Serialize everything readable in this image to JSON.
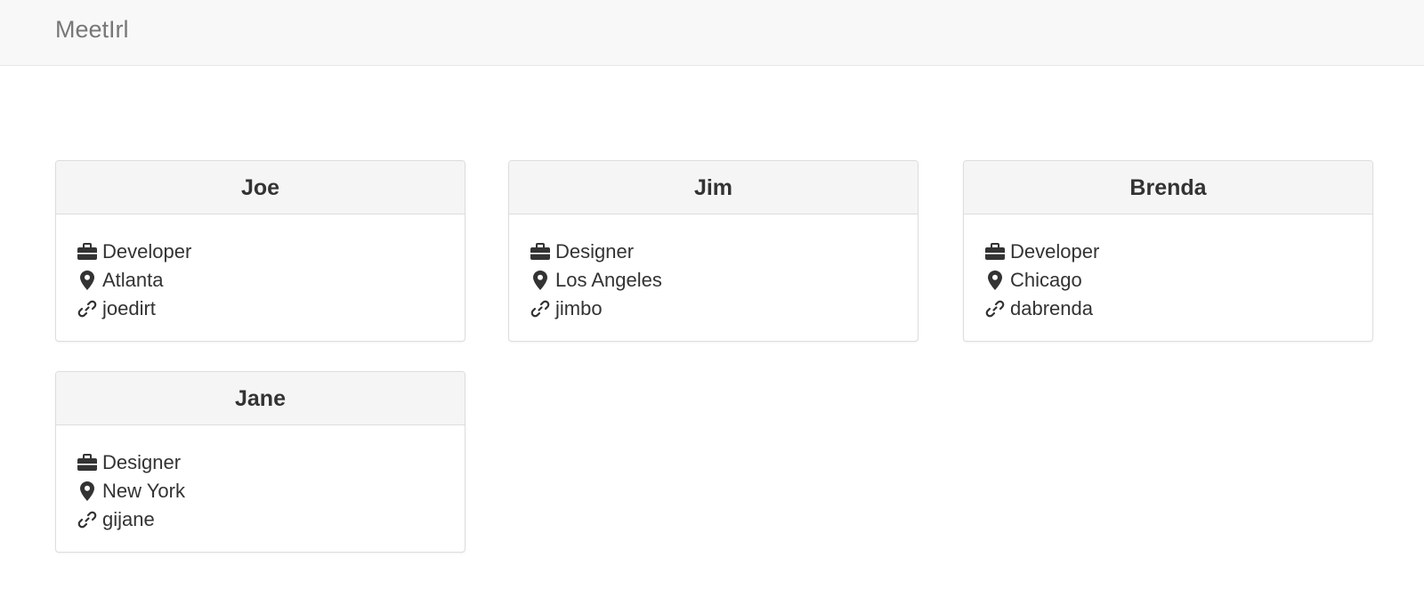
{
  "navbar": {
    "brand": "MeetIrl"
  },
  "people": [
    {
      "name": "Joe",
      "role": "Developer",
      "location": "Atlanta",
      "handle": "joedirt"
    },
    {
      "name": "Jim",
      "role": "Designer",
      "location": "Los Angeles",
      "handle": "jimbo"
    },
    {
      "name": "Brenda",
      "role": "Developer",
      "location": "Chicago",
      "handle": "dabrenda"
    },
    {
      "name": "Jane",
      "role": "Designer",
      "location": "New York",
      "handle": "gijane"
    }
  ],
  "icons": {
    "role": "briefcase-icon",
    "location": "map-marker-icon",
    "handle": "link-icon"
  },
  "colors": {
    "navbar_bg": "#f8f8f8",
    "brand_text": "#777777",
    "card_header_bg": "#f5f5f5",
    "card_border": "#dddddd",
    "text": "#333333"
  }
}
